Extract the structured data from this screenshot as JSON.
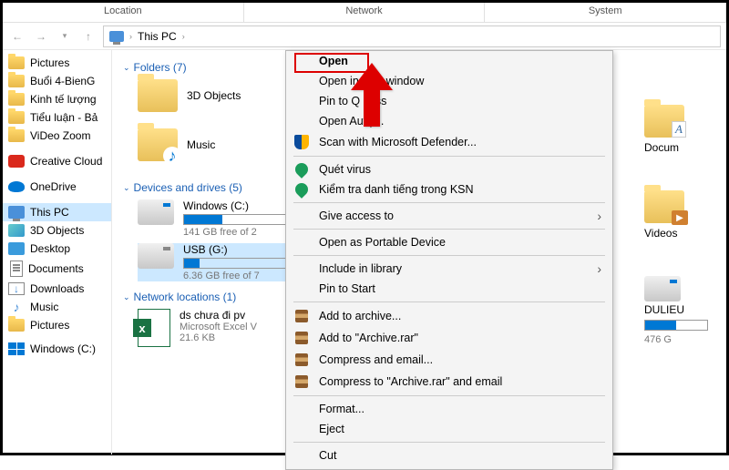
{
  "tabs": {
    "location": "Location",
    "network": "Network",
    "system": "System"
  },
  "breadcrumb": {
    "this_pc": "This PC",
    "chev": "›"
  },
  "sidebar": {
    "items": [
      {
        "label": "Pictures"
      },
      {
        "label": "Buổi 4-BienG"
      },
      {
        "label": "Kinh tế lượng"
      },
      {
        "label": "Tiểu luận - Bả"
      },
      {
        "label": "ViDeo Zoom"
      },
      {
        "label": "Creative Cloud"
      },
      {
        "label": "OneDrive"
      },
      {
        "label": "This PC"
      },
      {
        "label": "3D Objects"
      },
      {
        "label": "Desktop"
      },
      {
        "label": "Documents"
      },
      {
        "label": "Downloads"
      },
      {
        "label": "Music"
      },
      {
        "label": "Pictures"
      },
      {
        "label": "Windows (C:)"
      }
    ]
  },
  "groups": {
    "folders": {
      "title": "Folders (7)"
    },
    "drives": {
      "title": "Devices and drives (5)"
    },
    "network": {
      "title": "Network locations (1)"
    }
  },
  "folders": {
    "obj3d": "3D Objects",
    "music": "Music"
  },
  "drives": {
    "c": {
      "name": "Windows (C:)",
      "free": "141 GB free of 2",
      "fill": 36
    },
    "g": {
      "name": "USB (G:)",
      "free": "6.36 GB free of 7",
      "fill": 14
    }
  },
  "rightcol": {
    "docs": "Docum",
    "videos": "Videos",
    "du": {
      "name": "DULIEU",
      "free": "476 G",
      "fill": 50
    }
  },
  "netloc": {
    "name": "ds chưa đi pv",
    "type": "Microsoft Excel V",
    "size": "21.6 KB"
  },
  "ctx": {
    "open": "Open",
    "open_new": "Open in new window",
    "pin_quick": "Pin to Q          cess",
    "autoplay": "Open Aut       y...",
    "defender": "Scan with Microsoft Defender...",
    "scan_virus": "Quét virus",
    "ksn": "Kiểm tra danh tiếng trong KSN",
    "give_access": "Give access to",
    "portable": "Open as Portable Device",
    "include_lib": "Include in library",
    "pin_start": "Pin to Start",
    "add_archive": "Add to archive...",
    "add_rar": "Add to \"Archive.rar\"",
    "compress_email": "Compress and email...",
    "compress_rar_email": "Compress to \"Archive.rar\" and email",
    "format": "Format...",
    "eject": "Eject",
    "cut": "Cut"
  }
}
